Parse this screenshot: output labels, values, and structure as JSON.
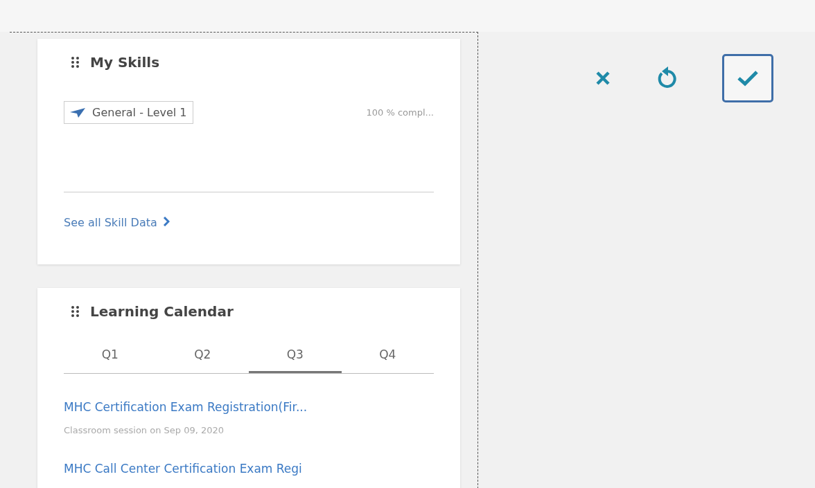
{
  "cards": [
    {
      "kind": "skills",
      "title": "My Skills",
      "skills": [
        {
          "name": "General - Level 1",
          "progress": "100 % compl..."
        }
      ],
      "link": "See all Skill Data"
    },
    {
      "kind": "calendar",
      "title": "Learning Calendar",
      "tabs": [
        {
          "label": "Q1",
          "selected": false
        },
        {
          "label": "Q2",
          "selected": false
        },
        {
          "label": "Q3",
          "selected": true
        },
        {
          "label": "Q4",
          "selected": false
        }
      ],
      "items": [
        {
          "title": "MHC Certification Exam Registration(Fir...",
          "subtitle": "Classroom session on Sep 09, 2020"
        },
        {
          "title": "MHC Call Center Certification Exam Regi"
        }
      ]
    }
  ],
  "actions": [
    {
      "kind": "cancel"
    },
    {
      "kind": "reset"
    },
    {
      "kind": "confirm"
    }
  ]
}
